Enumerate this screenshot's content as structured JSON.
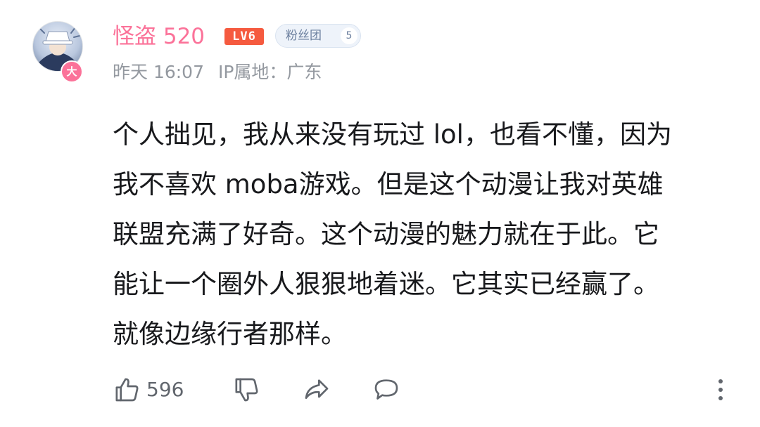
{
  "comment": {
    "user": {
      "name": "怪盗 520",
      "level": "LV6",
      "avatar_badge": "大",
      "fan_badge_label": "粉丝团",
      "fan_badge_level": "5"
    },
    "meta": {
      "time": "昨天 16:07",
      "ip_location": "IP属地：广东"
    },
    "content_lines": [
      "个人拙见，我从来没有玩过 lol，也看不懂，因为",
      "我不喜欢 moba游戏。但是这个动漫让我对英雄",
      "联盟充满了好奇。这个动漫的魅力就在于此。它",
      "能让一个圈外人狠狠地着迷。它其实已经赢了。",
      "就像边缘行者那样。"
    ],
    "actions": {
      "like_count": "596"
    },
    "icons": {
      "like": "thumbs-up-icon",
      "dislike": "thumbs-down-icon",
      "share": "share-icon",
      "reply": "comment-icon",
      "more": "more-vertical-icon"
    },
    "colors": {
      "username": "#fb7299",
      "level_badge": "#f55a3f",
      "meta_text": "#9499a0",
      "icon": "#61666d"
    }
  }
}
